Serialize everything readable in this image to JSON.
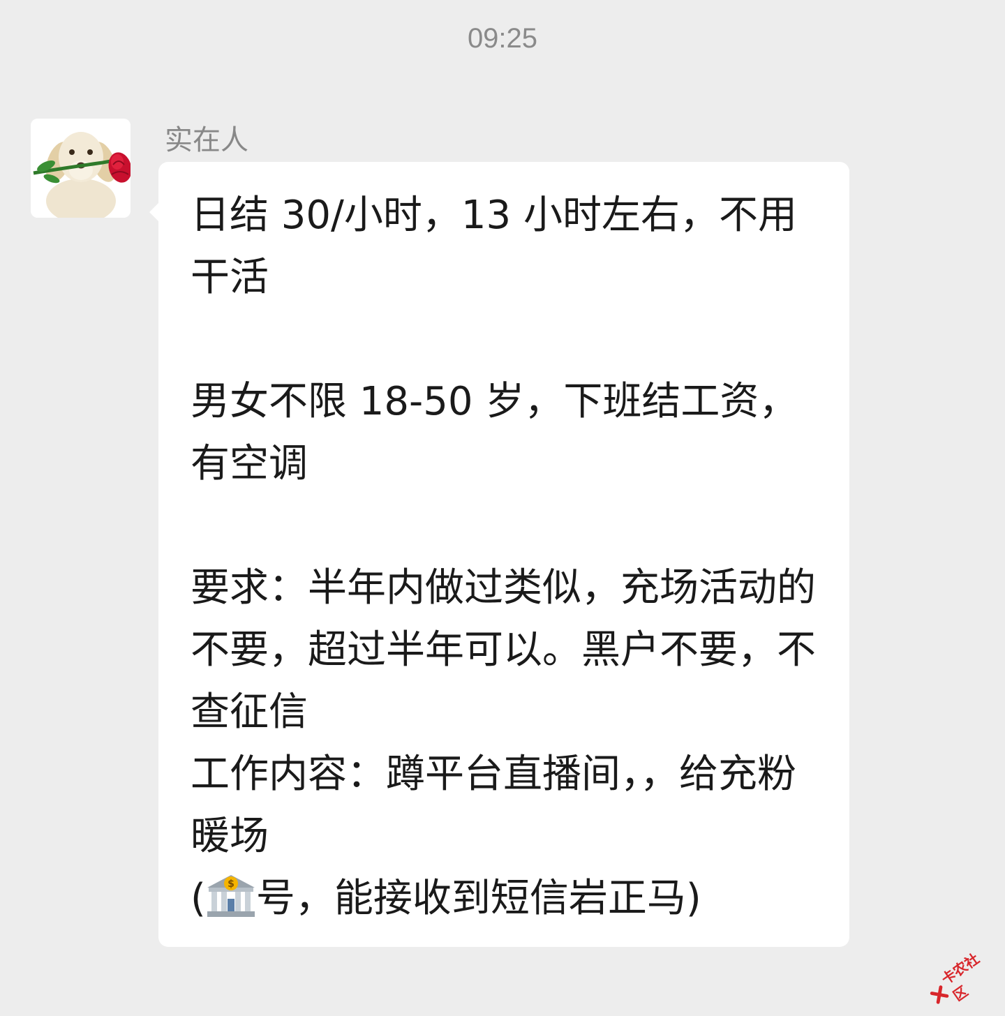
{
  "chat": {
    "timestamp": "09:25",
    "sender": {
      "name": "实在人",
      "avatar_icon": "dog-with-rose-avatar"
    },
    "message": {
      "lines": [
        "日结 30/小时，13 小时左右，不用干活",
        "",
        "男女不限 18-50 岁，下班结工资，有空调",
        "",
        "要求：半年内做过类似，充场活动的不要，超过半年可以。黑户不要，不查征信",
        "工作内容：蹲平台直播间，，给充粉暖场"
      ],
      "last_line_prefix": "(",
      "last_line_emoji": "bank-icon",
      "last_line_suffix": "号，能接收到短信岩正马)"
    }
  },
  "watermark": {
    "text": "卡农社区",
    "color": "#d8262b"
  }
}
